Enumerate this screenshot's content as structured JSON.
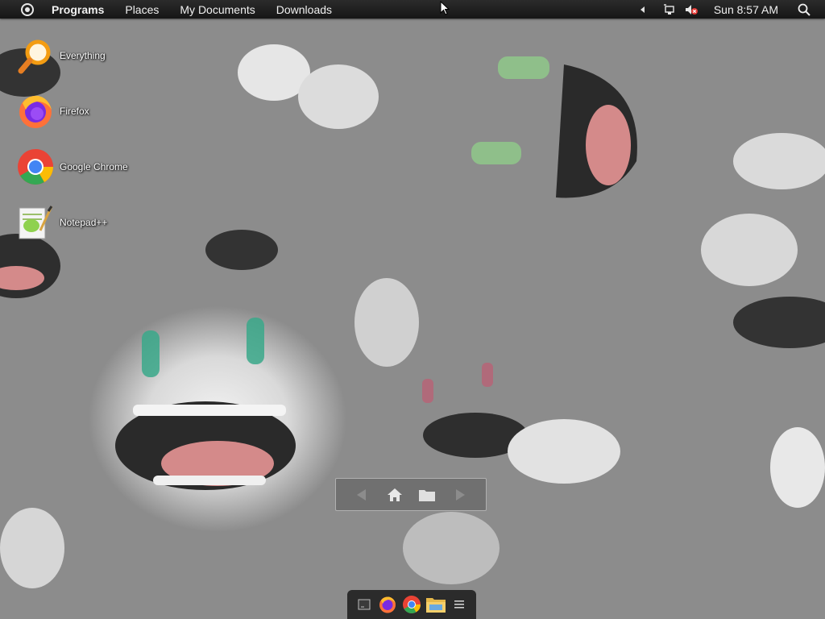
{
  "top_panel": {
    "menu_icon": "system-menu-icon",
    "menus": [
      {
        "label": "Programs",
        "bold": true
      },
      {
        "label": "Places",
        "bold": false
      },
      {
        "label": "My Documents",
        "bold": false
      },
      {
        "label": "Downloads",
        "bold": false
      }
    ],
    "tray": {
      "expand_icon": "tray-expand-arrow-icon",
      "network_icon": "network-icon",
      "volume_icon": "volume-muted-icon",
      "clock": "Sun 8:57 AM",
      "search_icon": "search-icon"
    }
  },
  "desktop_icons": [
    {
      "label": "Everything",
      "icon": "everything-search-icon"
    },
    {
      "label": "Firefox",
      "icon": "firefox-icon"
    },
    {
      "label": "Google Chrome",
      "icon": "chrome-icon"
    },
    {
      "label": "Notepad++",
      "icon": "notepad-plus-plus-icon"
    }
  ],
  "nav_toolbar": {
    "buttons": [
      "back-arrow-icon",
      "home-icon",
      "folder-icon",
      "forward-arrow-icon"
    ]
  },
  "dock": {
    "items": [
      "terminal-icon",
      "firefox-icon",
      "chrome-icon",
      "file-manager-icon",
      "menu-icon"
    ]
  },
  "colors": {
    "panel_bg": "#1e1e1e",
    "panel_text": "#f0f0f0",
    "volume_muted": "#e53935",
    "chrome_red": "#ea4335",
    "chrome_green": "#34a853",
    "chrome_yellow": "#fbbc05",
    "chrome_blue": "#4285f4",
    "everything_orange": "#f39c12"
  }
}
